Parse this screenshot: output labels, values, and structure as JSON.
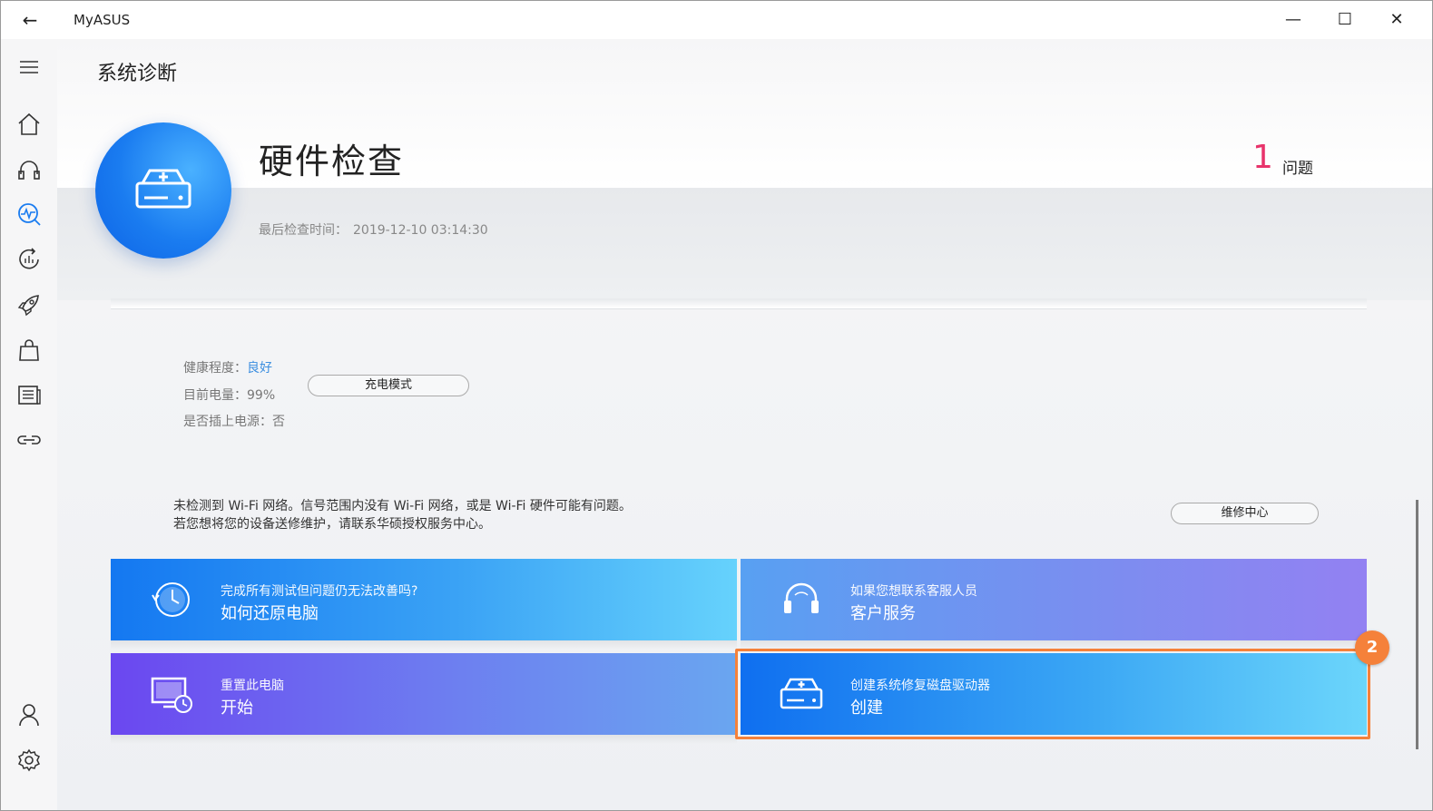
{
  "window": {
    "title": "MyASUS",
    "back_glyph": "←",
    "minimize_glyph": "—",
    "maximize_glyph": "☐",
    "close_glyph": "✕"
  },
  "sidebar": {
    "menu_icon": "hamburger-menu-icon",
    "items": [
      {
        "name": "home",
        "icon": "home-icon"
      },
      {
        "name": "support",
        "icon": "headset-icon"
      },
      {
        "name": "diagnostics",
        "icon": "diagnostics-icon",
        "active": true
      },
      {
        "name": "update",
        "icon": "refresh-icon"
      },
      {
        "name": "optimize",
        "icon": "rocket-icon"
      },
      {
        "name": "store",
        "icon": "shopping-bag-icon"
      },
      {
        "name": "news",
        "icon": "news-icon"
      },
      {
        "name": "link",
        "icon": "link-icon"
      },
      {
        "name": "account",
        "icon": "user-icon"
      },
      {
        "name": "settings",
        "icon": "gear-icon"
      }
    ],
    "accent": "#1a7cf0"
  },
  "page": {
    "title": "系统诊断"
  },
  "hero": {
    "title": "硬件检查",
    "issue_count": "1",
    "issue_label": "问题",
    "last_check_label": "最后检查时间：",
    "last_check_value": "2019-12-10 03:14:30",
    "icon": "hard-drive-plus-icon",
    "issue_color": "#e8336b"
  },
  "battery": {
    "health_label": "健康程度：",
    "health_value": "良好",
    "charge_label": "目前电量：",
    "charge_value": "99%",
    "plugged_label": "是否插上电源：",
    "plugged_value": "否",
    "mode_button": "充电模式"
  },
  "wifi": {
    "line1": "未检测到 Wi-Fi 网络。信号范围内没有 Wi-Fi 网络，或是 Wi-Fi 硬件可能有问题。",
    "line2": "若您想将您的设备送修维护，请联系华硕授权服务中心。",
    "service_button": "维修中心"
  },
  "tiles": [
    {
      "sub": "完成所有测试但问题仍无法改善吗?",
      "main": "如何还原电脑",
      "icon": "clock-restore-icon"
    },
    {
      "sub": "如果您想联系客服人员",
      "main": "客户服务",
      "icon": "headset-icon"
    },
    {
      "sub": "重置此电脑",
      "main": "开始",
      "icon": "monitor-reset-icon"
    },
    {
      "sub": "创建系统修复磁盘驱动器",
      "main": "创建",
      "icon": "hard-drive-plus-icon"
    }
  ],
  "annotation": {
    "step": "2",
    "color": "#f5813a"
  }
}
